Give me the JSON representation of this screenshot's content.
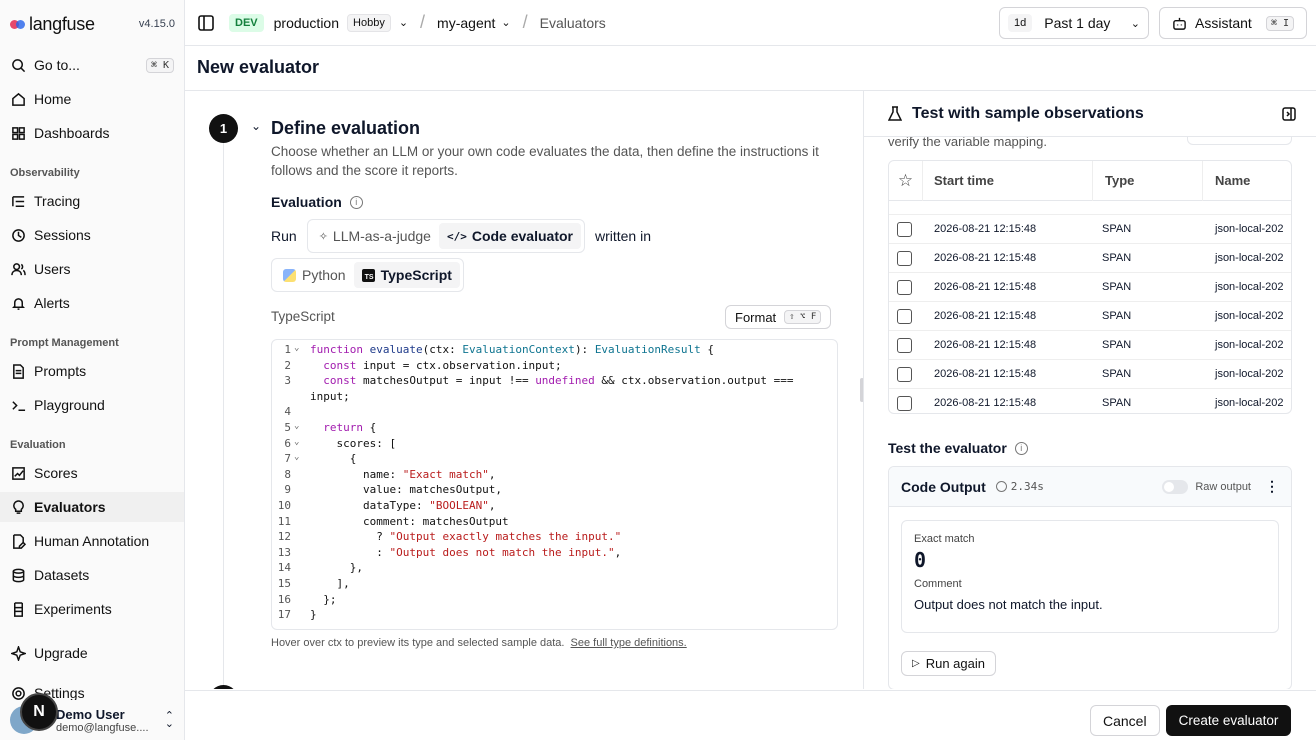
{
  "app": {
    "logo": "langfuse",
    "version": "v4.15.0"
  },
  "sidebar": {
    "goto": {
      "label": "Go to...",
      "shortcut": "⌘ K"
    },
    "top_items": [
      {
        "label": "Home"
      },
      {
        "label": "Dashboards"
      }
    ],
    "sections": [
      {
        "label": "Observability",
        "items": [
          {
            "label": "Tracing"
          },
          {
            "label": "Sessions"
          },
          {
            "label": "Users"
          },
          {
            "label": "Alerts"
          }
        ]
      },
      {
        "label": "Prompt Management",
        "items": [
          {
            "label": "Prompts"
          },
          {
            "label": "Playground"
          }
        ]
      },
      {
        "label": "Evaluation",
        "items": [
          {
            "label": "Scores"
          },
          {
            "label": "Evaluators"
          },
          {
            "label": "Human Annotation"
          },
          {
            "label": "Datasets"
          },
          {
            "label": "Experiments"
          }
        ]
      }
    ],
    "bottom_items": [
      {
        "label": "Upgrade"
      },
      {
        "label": "Settings"
      }
    ],
    "user": {
      "name": "Demo User",
      "email": "demo@langfuse...."
    },
    "bubble": "N"
  },
  "topbar": {
    "env": "DEV",
    "project": "production",
    "plan": "Hobby",
    "agent": "my-agent",
    "page": "Evaluators",
    "time_short": "1d",
    "time_label": "Past 1 day",
    "assistant": "Assistant",
    "assistant_kbd": "⌘ I"
  },
  "page_title": "New evaluator",
  "step": {
    "number": "1",
    "title": "Define evaluation",
    "description_1": "Choose whether an LLM or your own code evaluates the data, then define the instructions it",
    "description_2": "follows and the score it reports.",
    "evaluation_label": "Evaluation",
    "run_label": "Run",
    "mode_llm": "LLM-as-a-judge",
    "mode_code": "Code evaluator",
    "written_in": "written in",
    "lang_python": "Python",
    "lang_ts": "TypeScript",
    "editor_label": "TypeScript",
    "format_label": "Format",
    "format_kbd": "⇧ ⌥ F",
    "hint": "Hover over ctx to preview its type and selected sample data.",
    "hint_link": "See full type definitions."
  },
  "code_lines": [
    "function evaluate(ctx: EvaluationContext): EvaluationResult {",
    "  const input = ctx.observation.input;",
    "  const matchesOutput = input !== undefined && ctx.observation.output ===",
    "input;",
    "",
    "  return {",
    "    scores: [",
    "      {",
    "        name: \"Exact match\",",
    "        value: matchesOutput,",
    "        dataType: \"BOOLEAN\",",
    "        comment: matchesOutput",
    "          ? \"Output exactly matches the input.\"",
    "          : \"Output does not match the input.\",",
    "      },",
    "    ],",
    "  };",
    "}"
  ],
  "line_numbers": [
    "1",
    "2",
    "3",
    "",
    "4",
    "5",
    "6",
    "7",
    "8",
    "9",
    "10",
    "11",
    "12",
    "13",
    "14",
    "15",
    "16",
    "17"
  ],
  "test_panel": {
    "title": "Test with sample observations",
    "partial_text": "verify the variable mapping.",
    "columns": [
      "Start time",
      "Type",
      "Name"
    ],
    "rows": [
      {
        "start": "2026-08-21 12:15:48",
        "type": "SPAN",
        "name": "json-local-202"
      },
      {
        "start": "2026-08-21 12:15:48",
        "type": "SPAN",
        "name": "json-local-202"
      },
      {
        "start": "2026-08-21 12:15:48",
        "type": "SPAN",
        "name": "json-local-202"
      },
      {
        "start": "2026-08-21 12:15:48",
        "type": "SPAN",
        "name": "json-local-202"
      },
      {
        "start": "2026-08-21 12:15:48",
        "type": "SPAN",
        "name": "json-local-202"
      },
      {
        "start": "2026-08-21 12:15:48",
        "type": "SPAN",
        "name": "json-local-202"
      },
      {
        "start": "2026-08-21 12:15:48",
        "type": "SPAN",
        "name": "json-local-202"
      }
    ],
    "test_label": "Test the evaluator",
    "output_title": "Code Output",
    "duration": "2.34s",
    "raw_output": "Raw output",
    "score_name": "Exact match",
    "score_value": "0",
    "comment_label": "Comment",
    "comment_value": "Output does not match the input.",
    "run_again": "Run again"
  },
  "footer": {
    "cancel": "Cancel",
    "create": "Create evaluator"
  },
  "colors": {
    "dev_badge": "#dcfce7",
    "string": "#b91c1c",
    "keyword": "#a21caf",
    "type": "#0e7490"
  }
}
